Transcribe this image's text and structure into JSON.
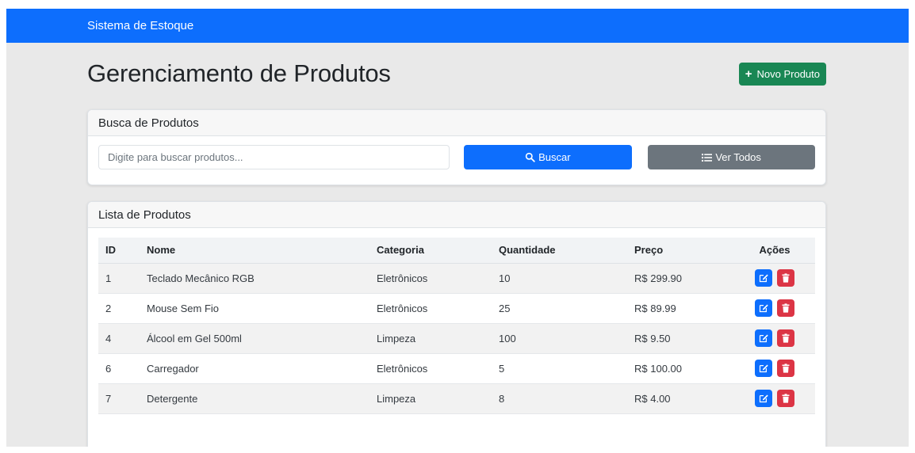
{
  "navbar": {
    "brand": "Sistema de Estoque"
  },
  "header": {
    "title": "Gerenciamento de Produtos",
    "new_button": "Novo Produto"
  },
  "search": {
    "card_title": "Busca de Produtos",
    "placeholder": "Digite para buscar produtos...",
    "search_button": "Buscar",
    "all_button": "Ver Todos"
  },
  "list": {
    "card_title": "Lista de Produtos",
    "columns": {
      "id": "ID",
      "nome": "Nome",
      "categoria": "Categoria",
      "quantidade": "Quantidade",
      "preco": "Preço",
      "acoes": "Ações"
    },
    "rows": [
      {
        "id": "1",
        "nome": "Teclado Mecânico RGB",
        "categoria": "Eletrônicos",
        "quantidade": "10",
        "preco": "R$ 299.90"
      },
      {
        "id": "2",
        "nome": "Mouse Sem Fio",
        "categoria": "Eletrônicos",
        "quantidade": "25",
        "preco": "R$ 89.99"
      },
      {
        "id": "4",
        "nome": "Álcool em Gel 500ml",
        "categoria": "Limpeza",
        "quantidade": "100",
        "preco": "R$ 9.50"
      },
      {
        "id": "6",
        "nome": "Carregador",
        "categoria": "Eletrônicos",
        "quantidade": "5",
        "preco": "R$ 100.00"
      },
      {
        "id": "7",
        "nome": "Detergente",
        "categoria": "Limpeza",
        "quantidade": "8",
        "preco": "R$ 4.00"
      }
    ]
  },
  "icons": {
    "plus": "plus-icon",
    "search": "search-icon",
    "list": "list-icon",
    "edit": "edit-icon",
    "delete": "trash-icon"
  },
  "colors": {
    "navbar": "#0d6efd",
    "success": "#198754",
    "primary": "#0d6efd",
    "secondary": "#6c757d",
    "danger": "#dc3545"
  }
}
